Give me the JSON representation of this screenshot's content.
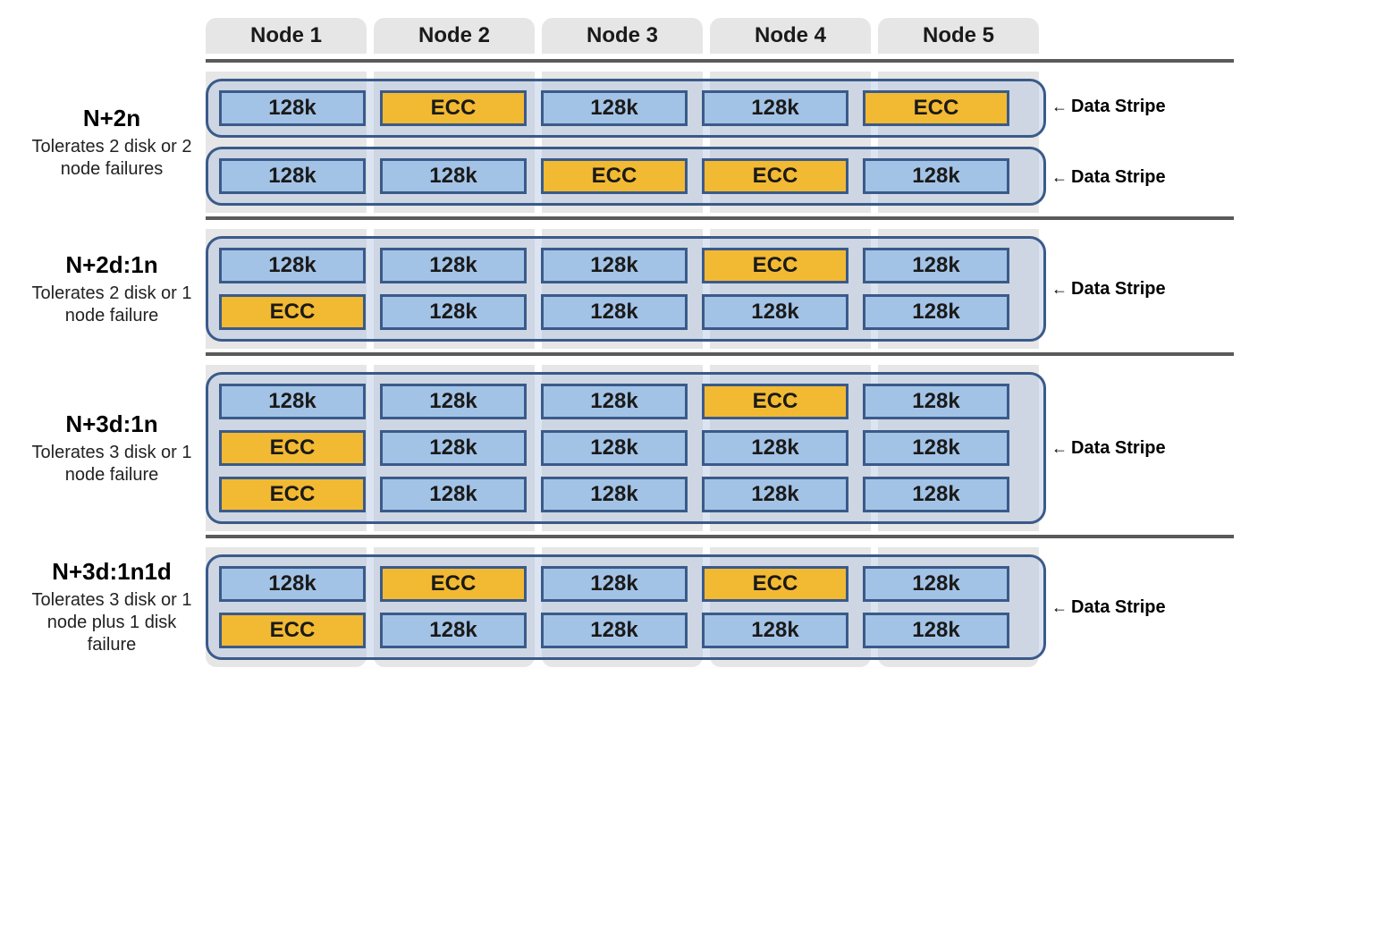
{
  "nodes": [
    "Node 1",
    "Node 2",
    "Node 3",
    "Node 4",
    "Node 5"
  ],
  "block_labels": {
    "data": "128k",
    "ecc": "ECC"
  },
  "stripe_label": "Data Stripe",
  "sections": [
    {
      "title": "N+2n",
      "desc": "Tolerates 2 disk or 2 node failures",
      "stripes": [
        {
          "rows": [
            [
              "data",
              "ecc",
              "data",
              "data",
              "ecc"
            ]
          ]
        },
        {
          "rows": [
            [
              "data",
              "data",
              "ecc",
              "ecc",
              "data"
            ]
          ]
        }
      ],
      "labels_count": 2
    },
    {
      "title": "N+2d:1n",
      "desc": "Tolerates 2 disk or 1 node failure",
      "stripes": [
        {
          "rows": [
            [
              "data",
              "data",
              "data",
              "ecc",
              "data"
            ],
            [
              "ecc",
              "data",
              "data",
              "data",
              "data"
            ]
          ]
        }
      ],
      "labels_count": 1
    },
    {
      "title": "N+3d:1n",
      "desc": "Tolerates 3 disk or 1 node failure",
      "stripes": [
        {
          "rows": [
            [
              "data",
              "data",
              "data",
              "ecc",
              "data"
            ],
            [
              "ecc",
              "data",
              "data",
              "data",
              "data"
            ],
            [
              "ecc",
              "data",
              "data",
              "data",
              "data"
            ]
          ]
        }
      ],
      "labels_count": 1
    },
    {
      "title": "N+3d:1n1d",
      "desc": "Tolerates 3 disk or 1 node plus 1 disk failure",
      "stripes": [
        {
          "rows": [
            [
              "data",
              "ecc",
              "data",
              "ecc",
              "data"
            ],
            [
              "ecc",
              "data",
              "data",
              "data",
              "data"
            ]
          ]
        }
      ],
      "labels_count": 1
    }
  ]
}
